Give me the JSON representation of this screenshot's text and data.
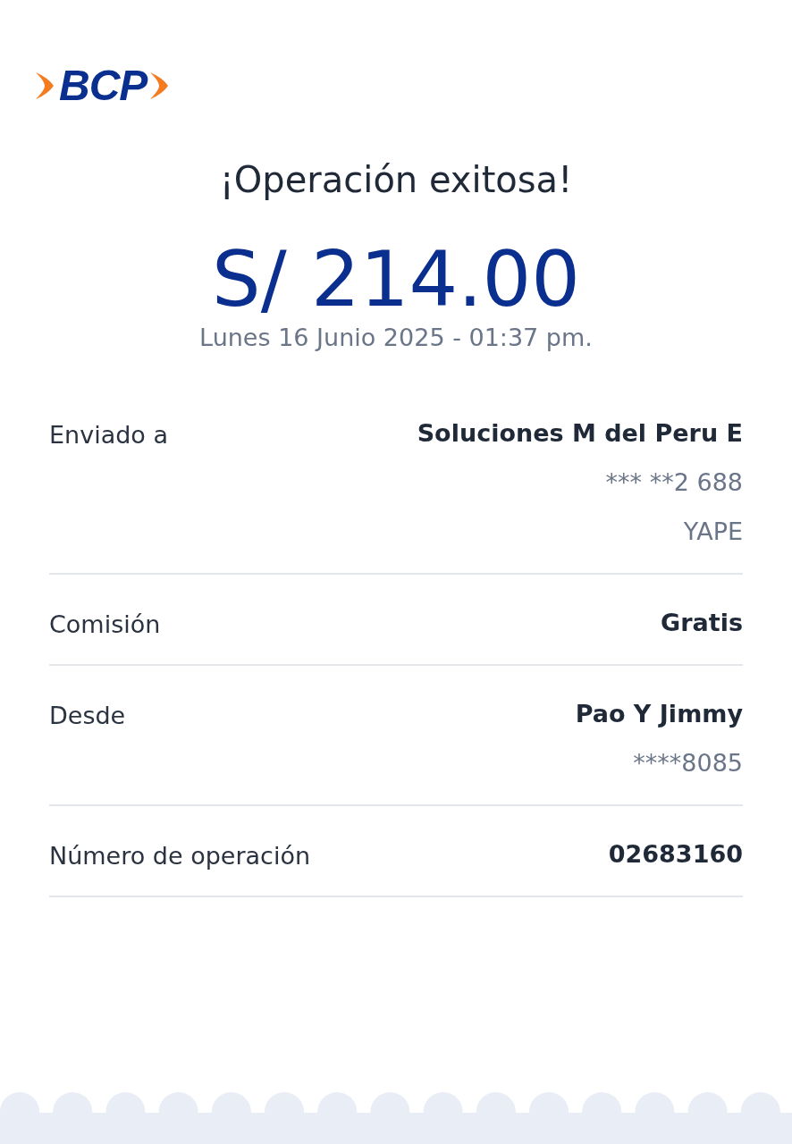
{
  "logo": {
    "text": "BCP"
  },
  "title": "¡Operación exitosa!",
  "amount": "S/ 214.00",
  "datetime": "Lunes 16 Junio 2025 - 01:37 pm.",
  "details": [
    {
      "label": "Enviado a",
      "value": "Soluciones M del Peru E",
      "extra": [
        "*** **2 688",
        "YAPE"
      ]
    },
    {
      "label": "Comisión",
      "value": "Gratis"
    },
    {
      "label": "Desde",
      "value": "Pao Y Jimmy",
      "extra": [
        "****8085"
      ]
    },
    {
      "label": "Número de operación",
      "value": "02683160"
    }
  ]
}
